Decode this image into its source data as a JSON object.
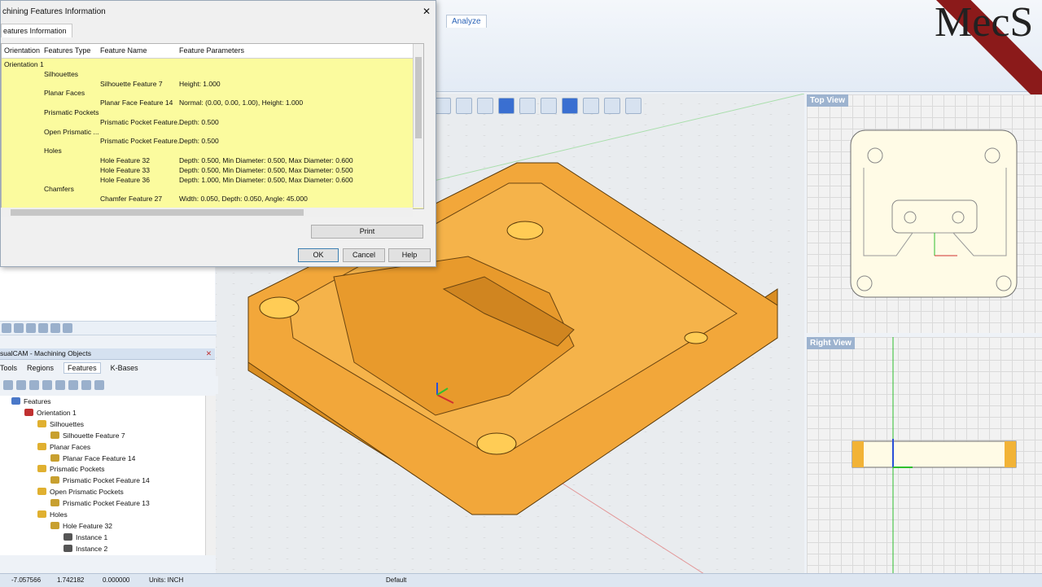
{
  "ribbon": {
    "tab": "Analyze"
  },
  "logo": {
    "text": "MecS"
  },
  "views": {
    "top_title": "Top View",
    "right_title": "Right View"
  },
  "dialog": {
    "title": "chining Features Information",
    "tab": "eatures Information",
    "columns": [
      "Orientation",
      "Features Type",
      "Feature Name",
      "Feature Parameters"
    ],
    "rows": [
      {
        "orientation": "Orientation 1",
        "type": "",
        "name": "",
        "params": ""
      },
      {
        "orientation": "",
        "type": "Silhouettes",
        "name": "",
        "params": ""
      },
      {
        "orientation": "",
        "type": "",
        "name": "Silhouette Feature 7",
        "params": "Height: 1.000"
      },
      {
        "orientation": "",
        "type": "Planar Faces",
        "name": "",
        "params": ""
      },
      {
        "orientation": "",
        "type": "",
        "name": "Planar Face Feature 14",
        "params": "Normal: (0.00, 0.00, 1.00), Height: 1.000"
      },
      {
        "orientation": "",
        "type": "Prismatic Pockets",
        "name": "",
        "params": ""
      },
      {
        "orientation": "",
        "type": "",
        "name": "Prismatic Pocket Feature...",
        "params": "Depth: 0.500"
      },
      {
        "orientation": "",
        "type": "Open Prismatic ...",
        "name": "",
        "params": ""
      },
      {
        "orientation": "",
        "type": "",
        "name": "Prismatic Pocket Feature...",
        "params": "Depth: 0.500"
      },
      {
        "orientation": "",
        "type": "Holes",
        "name": "",
        "params": ""
      },
      {
        "orientation": "",
        "type": "",
        "name": "Hole Feature 32",
        "params": "Depth: 0.500, Min Diameter: 0.500, Max Diameter: 0.600"
      },
      {
        "orientation": "",
        "type": "",
        "name": "Hole Feature 33",
        "params": "Depth: 0.500, Min Diameter: 0.500, Max Diameter: 0.500"
      },
      {
        "orientation": "",
        "type": "",
        "name": "Hole Feature 36",
        "params": "Depth: 1.000, Min Diameter: 0.500, Max Diameter: 0.600"
      },
      {
        "orientation": "",
        "type": "Chamfers",
        "name": "",
        "params": ""
      },
      {
        "orientation": "",
        "type": "",
        "name": "Chamfer Feature 27",
        "params": "Width: 0.050, Depth: 0.050, Angle: 45.000"
      }
    ],
    "buttons": {
      "print": "Print",
      "ok": "OK",
      "cancel": "Cancel",
      "help": "Help"
    }
  },
  "machining_objects": {
    "title": "sualCAM - Machining Objects",
    "tabs": [
      "Tools",
      "Regions",
      "Features",
      "K-Bases"
    ],
    "tree": [
      {
        "label": "Features",
        "level": 0,
        "icon": "features-icon"
      },
      {
        "label": "Orientation 1",
        "level": 1,
        "icon": "orientation-icon"
      },
      {
        "label": "Silhouettes",
        "level": 2,
        "icon": "folder-icon"
      },
      {
        "label": "Silhouette Feature 7",
        "level": 3,
        "icon": "feature-icon"
      },
      {
        "label": "Planar Faces",
        "level": 2,
        "icon": "folder-icon"
      },
      {
        "label": "Planar Face Feature 14",
        "level": 3,
        "icon": "feature-icon"
      },
      {
        "label": "Prismatic Pockets",
        "level": 2,
        "icon": "folder-icon"
      },
      {
        "label": "Prismatic Pocket Feature 14",
        "level": 3,
        "icon": "feature-icon"
      },
      {
        "label": "Open Prismatic Pockets",
        "level": 2,
        "icon": "folder-icon"
      },
      {
        "label": "Prismatic Pocket Feature 13",
        "level": 3,
        "icon": "feature-icon"
      },
      {
        "label": "Holes",
        "level": 2,
        "icon": "folder-icon"
      },
      {
        "label": "Hole Feature 32",
        "level": 3,
        "icon": "feature-icon"
      },
      {
        "label": "Instance 1",
        "level": 4,
        "icon": "instance-icon"
      },
      {
        "label": "Instance 2",
        "level": 4,
        "icon": "instance-icon"
      }
    ]
  },
  "status": {
    "x": "-7.057566",
    "y": "1.742182",
    "z": "0.000000",
    "units": "Units: INCH",
    "layer": "Default"
  },
  "colors": {
    "part": "#f2a73a",
    "grid_highlight": "#fbfb9e",
    "accent": "#2b63b7"
  }
}
